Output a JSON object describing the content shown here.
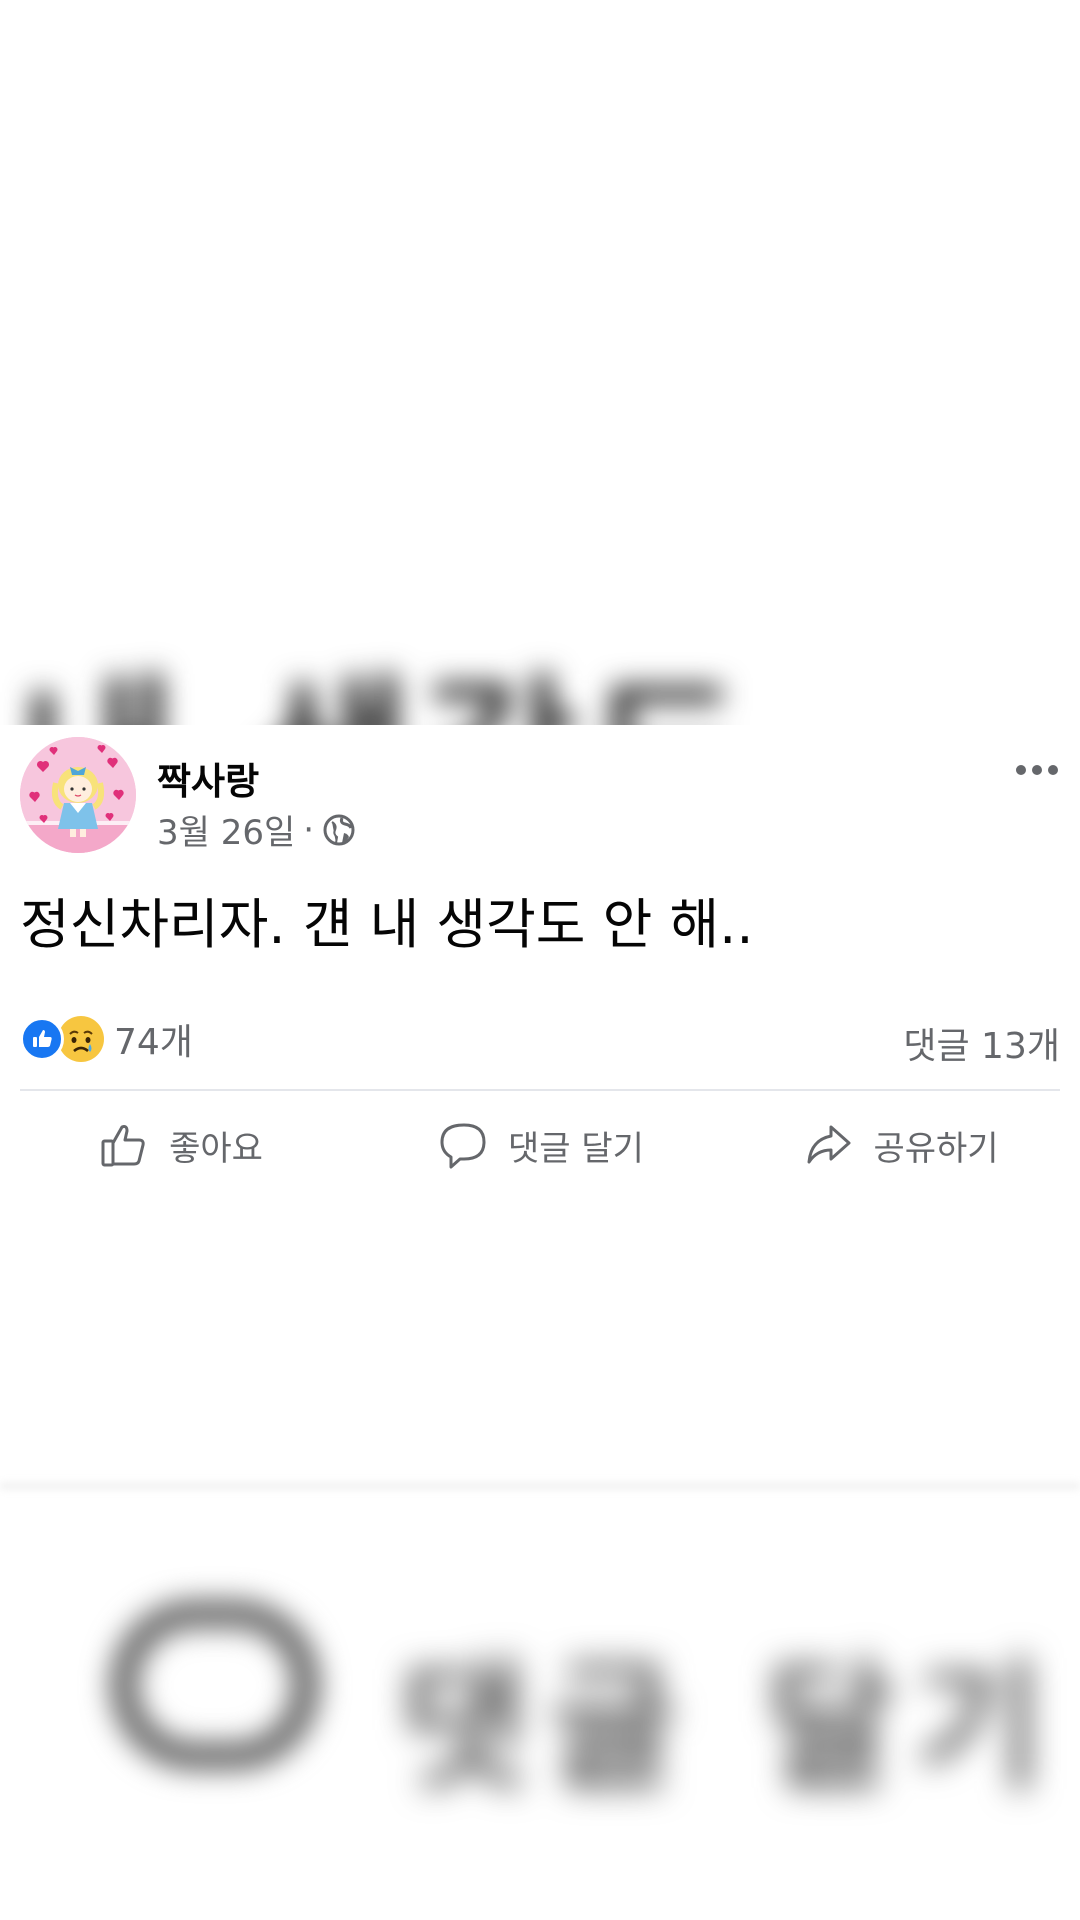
{
  "post": {
    "author": "짝사랑",
    "date": "3월 26일",
    "separator": "·",
    "privacy_icon": "globe-icon",
    "more_icon": "more-options-icon",
    "text": "정신차리자. 걘 내 생각도 안 해..",
    "reactions": {
      "icons": [
        "like-icon",
        "sad-icon"
      ],
      "count": "74개"
    },
    "comments_count": "댓글 13개",
    "actions": {
      "like_label": "좋아요",
      "comment_label": "댓글 달기",
      "share_label": "공유하기"
    }
  },
  "background": {
    "top_blurred_text": "내 생각도",
    "bottom_blurred_text": "댓글 달기"
  },
  "colors": {
    "like_blue": "#1877f2",
    "meta_gray": "#65676b",
    "sad_yellow": "#f7c640",
    "text": "#050505"
  }
}
